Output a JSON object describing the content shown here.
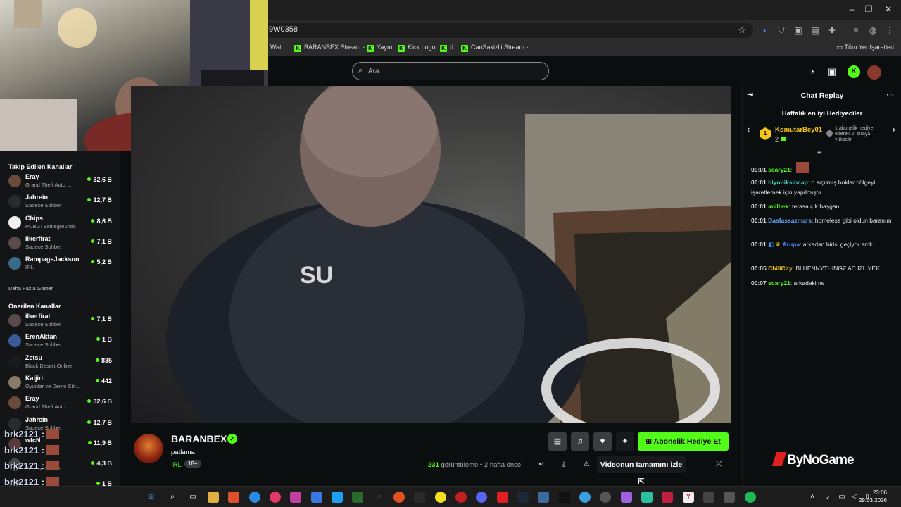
{
  "browser": {
    "url_fragment": "9W0358",
    "bookmarks": [
      {
        "label": "Wat..."
      },
      {
        "label": "BARANBEX Stream -..."
      },
      {
        "label": "Yayın"
      },
      {
        "label": "Kick Logo"
      },
      {
        "label": "d"
      },
      {
        "label": "CanSakizlii Stream -..."
      }
    ],
    "all_bookmarks": "Tüm Yer İşaretleri"
  },
  "header": {
    "search_placeholder": "Ara"
  },
  "sidebar": {
    "followed_title": "Takip Edilen Kanallar",
    "followed": [
      {
        "name": "Eray",
        "category": "Grand Theft Auto ...",
        "viewers": "32,6 B",
        "color": "#6a4a3a"
      },
      {
        "name": "Jahrein",
        "category": "Sadece Sohbet",
        "viewers": "12,7 B",
        "color": "#2b2b2b"
      },
      {
        "name": "Chips",
        "category": "PUBG: Battlegrounds",
        "viewers": "8,6 B",
        "color": "#f0f0f0"
      },
      {
        "name": "ilkerfirat",
        "category": "Sadece Sohbet",
        "viewers": "7,1 B",
        "color": "#5a4a4a"
      },
      {
        "name": "RampageJackson",
        "category": "IRL",
        "viewers": "5,2 B",
        "color": "#3a6a8a"
      }
    ],
    "more_label": "Daha Fazla Göster",
    "recommended_title": "Önerilen Kanallar",
    "recommended": [
      {
        "name": "ilkerfirat",
        "category": "Sadece Sohbet",
        "viewers": "7,1 B",
        "color": "#5a4a4a"
      },
      {
        "name": "ErenAktan",
        "category": "Sadece Sohbet",
        "viewers": "1 B",
        "color": "#3a5a9a"
      },
      {
        "name": "Zetsu",
        "category": "Black Desert Online",
        "viewers": "835",
        "color": "#1a1a1a"
      },
      {
        "name": "Kaijiri",
        "category": "Oyunlar ve Demo Sür...",
        "viewers": "442",
        "color": "#8a7a6a"
      },
      {
        "name": "Eray",
        "category": "Grand Theft Auto ...",
        "viewers": "32,6 B",
        "color": "#6a4a3a"
      },
      {
        "name": "Jahrein",
        "category": "Sadece Sohbet",
        "viewers": "12,7 B",
        "color": "#2b2b2b"
      },
      {
        "name": "wtcN",
        "category": "",
        "viewers": "11,9 B",
        "color": "#5a3a3a"
      },
      {
        "name": "",
        "category": "Sadece Sohbet",
        "viewers": "4,3 B",
        "color": "#4a4a4a"
      },
      {
        "name": "",
        "category": "",
        "viewers": "1 B",
        "color": "#4a4a4a"
      }
    ]
  },
  "overlay_chat": [
    {
      "text": "brk2121 :"
    },
    {
      "text": "brk2121 :"
    },
    {
      "text": "brk2121 :"
    },
    {
      "text": "brk2121 :"
    },
    {
      "text": "brk2121 :"
    }
  ],
  "stream": {
    "streamer": "BARANBEX",
    "title": "patlama",
    "category": "IRL",
    "age_badge": "18+",
    "gift_sub_label": "Abonelik Hediye Et",
    "views_count": "231",
    "views_label": "görüntüleme",
    "posted": "2 hafta önce",
    "full_video_label": "Videonun tamamını izle"
  },
  "chat": {
    "title": "Chat Replay",
    "gifters_title": "Haftalık en iyi Hediyeciler",
    "top_gifter": {
      "rank": "1",
      "name": "KomutarBey01",
      "count": "2"
    },
    "gifter_note": "1 abonelik hediye ederek 2. sıraya yükselin",
    "messages": [
      {
        "time": "00:01",
        "user": "scary21",
        "color": "#53fc18",
        "text": ""
      },
      {
        "time": "00:01",
        "user": "biyoniksincap",
        "color": "#3fd3c8",
        "text": "o sıçılmış boklar bölgeyi işaretlemek için yapılmıştır"
      },
      {
        "time": "00:01",
        "user": "anilbek",
        "color": "#53fc18",
        "text": "terasa çık başgan"
      },
      {
        "time": "00:01",
        "user": "Dasfassazmars",
        "color": "#6aa8ff",
        "text": "homeless gibi oldun baranım"
      },
      {
        "time": "00:01",
        "user": "Arupa",
        "color": "#4a8aff",
        "text": "arkadan birisi geçiyor amk"
      },
      {
        "time": "00:05",
        "user": "ChillCity",
        "color": "#f5c518",
        "text": "BI HENNYTHINGZ AC IZLIYEK"
      },
      {
        "time": "00:07",
        "user": "scary21",
        "color": "#53fc18",
        "text": "arkadaki ne"
      }
    ]
  },
  "watermark": "ByNoGame",
  "taskbar": {
    "time": "23:06",
    "date": "29.03.2026"
  },
  "colors": {
    "accent": "#53fc18",
    "background": "#0b0e0f"
  }
}
